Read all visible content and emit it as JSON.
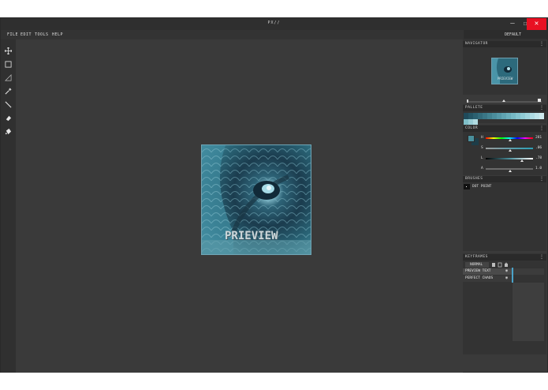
{
  "window": {
    "title": "PX//",
    "controls": {
      "minimize": "–",
      "maximize": "☐",
      "close": "✕"
    }
  },
  "menu": [
    "FILE",
    "EDIT",
    "TOOLS",
    "HELP"
  ],
  "preset": "DEFAULT",
  "tools": [
    "move-icon",
    "rect-select-icon",
    "triangle-select-icon",
    "eyedropper-icon",
    "line-icon",
    "eraser-icon",
    "fill-bucket-icon"
  ],
  "canvas": {
    "overlay_text": "PRIEVIEW"
  },
  "panels": {
    "navigator": {
      "title": "NAVIGATOR",
      "menu": "⋮",
      "thumb_text": "PRIEVIEW",
      "zoom_level": 0.62
    },
    "palette": {
      "title": "PALLETE",
      "menu": "⋮",
      "colors": [
        "#1f4a5a",
        "#245565",
        "#2b6070",
        "#326b7b",
        "#3a7686",
        "#428291",
        "#4b8d9c",
        "#5598a7",
        "#5fa3b1",
        "#6aaebb",
        "#76b9c5",
        "#83c3ce",
        "#90ccd6",
        "#9fd4dd",
        "#aedbe3",
        "#bee3e9",
        "#cdeaee"
      ],
      "second_row": [
        "#7fbfc9",
        "#98cdd5",
        "#b1dbe1"
      ]
    },
    "color": {
      "title": "COLOR",
      "menu": "⋮",
      "fg": "#4a8f9c",
      "bg": "#1d3d48",
      "channels": [
        {
          "label": "H",
          "value": "281",
          "pos": 0.78
        },
        {
          "label": "S",
          "value": ".06",
          "pos": 0.06
        },
        {
          "label": "L",
          "value": ".78",
          "pos": 0.78
        },
        {
          "label": "A",
          "value": "1.0",
          "pos": 1.0
        }
      ]
    },
    "brushes": {
      "title": "BRUSHES",
      "menu": "⋮",
      "items": [
        "DOT POINT"
      ]
    },
    "keyframes": {
      "title": "KEYFRAMES",
      "menu": "⋮",
      "blend_mode": "NORMAL",
      "layers": [
        {
          "name": "PREVIEW TEXT",
          "visible": true
        },
        {
          "name": "PERFECT CHAOS",
          "visible": true
        }
      ]
    }
  }
}
